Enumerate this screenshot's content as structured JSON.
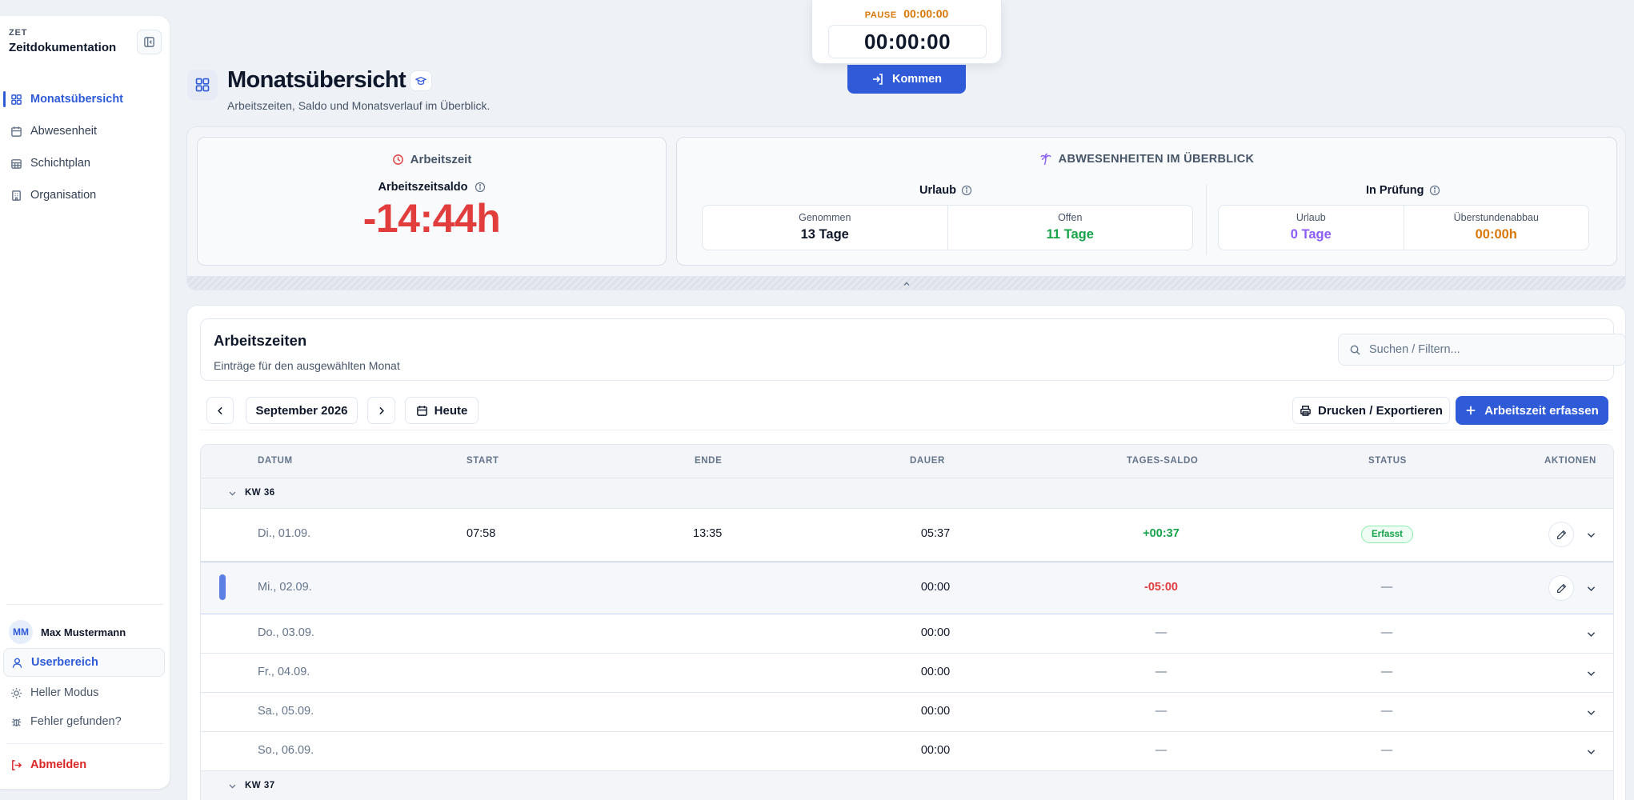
{
  "sidebar": {
    "brand_small": "ZET",
    "brand_title": "Zeitdokumentation",
    "nav": [
      {
        "label": "Monatsübersicht",
        "icon": "grid-icon",
        "active": true
      },
      {
        "label": "Abwesenheit",
        "icon": "calendar-icon",
        "active": false
      },
      {
        "label": "Schichtplan",
        "icon": "calendar-grid-icon",
        "active": false
      },
      {
        "label": "Organisation",
        "icon": "building-icon",
        "active": false
      }
    ],
    "user": {
      "initials": "MM",
      "name": "Max Mustermann"
    },
    "userbereich": "Userbereich",
    "heller_modus": "Heller Modus",
    "fehler": "Fehler gefunden?",
    "abmelden": "Abmelden"
  },
  "header": {
    "title": "Monatsübersicht",
    "subtitle": "Arbeitszeiten, Saldo und Monatsverlauf im Überblick."
  },
  "timer": {
    "pause_label": "PAUSE",
    "pause_value": "00:00:00",
    "main_value": "00:00:00",
    "kommen_label": "Kommen"
  },
  "summary": {
    "arbeitszeit": {
      "title": "Arbeitszeit",
      "saldo_label": "Arbeitszeitsaldo",
      "saldo_value": "-14:44h"
    },
    "abwesenheiten": {
      "title": "ABWESENHEITEN IM ÜBERBLICK",
      "urlaub": {
        "title": "Urlaub",
        "genommen_label": "Genommen",
        "genommen_value": "13 Tage",
        "offen_label": "Offen",
        "offen_value": "11 Tage"
      },
      "pruefung": {
        "title": "In Prüfung",
        "urlaub_label": "Urlaub",
        "urlaub_value": "0 Tage",
        "ueber_label": "Überstundenabbau",
        "ueber_value": "00:00h"
      }
    }
  },
  "arbeitszeiten": {
    "title": "Arbeitszeiten",
    "subtitle": "Einträge für den ausgewählten Monat",
    "search_placeholder": "Suchen / Filtern...",
    "month": "September 2026",
    "heute": "Heute",
    "drucken": "Drucken / Exportieren",
    "erfassen": "Arbeitszeit erfassen"
  },
  "table": {
    "headers": {
      "datum": "DATUM",
      "start": "START",
      "ende": "ENDE",
      "dauer": "DAUER",
      "saldo": "TAGES-SALDO",
      "status": "STATUS",
      "aktionen": "AKTIONEN"
    },
    "kw36": "KW 36",
    "kw37": "KW 37",
    "rows": [
      {
        "datum": "Di., 01.09.",
        "start": "07:58",
        "ende": "13:35",
        "dauer": "05:37",
        "saldo": "+00:37",
        "status": "Erfasst"
      },
      {
        "datum": "Mi., 02.09.",
        "start": "",
        "ende": "",
        "dauer": "00:00",
        "saldo": "-05:00",
        "status": "—"
      },
      {
        "datum": "Do., 03.09.",
        "start": "",
        "ende": "",
        "dauer": "00:00",
        "saldo": "—",
        "status": "—"
      },
      {
        "datum": "Fr., 04.09.",
        "start": "",
        "ende": "",
        "dauer": "00:00",
        "saldo": "—",
        "status": "—"
      },
      {
        "datum": "Sa., 05.09.",
        "start": "",
        "ende": "",
        "dauer": "00:00",
        "saldo": "—",
        "status": "—"
      },
      {
        "datum": "So., 06.09.",
        "start": "",
        "ende": "",
        "dauer": "00:00",
        "saldo": "—",
        "status": "—"
      }
    ]
  },
  "colors": {
    "accent": "#2f5bd8",
    "negative": "#e23d3d",
    "positive": "#16a34a",
    "warning": "#d97706",
    "purple": "#8b5cf6"
  }
}
